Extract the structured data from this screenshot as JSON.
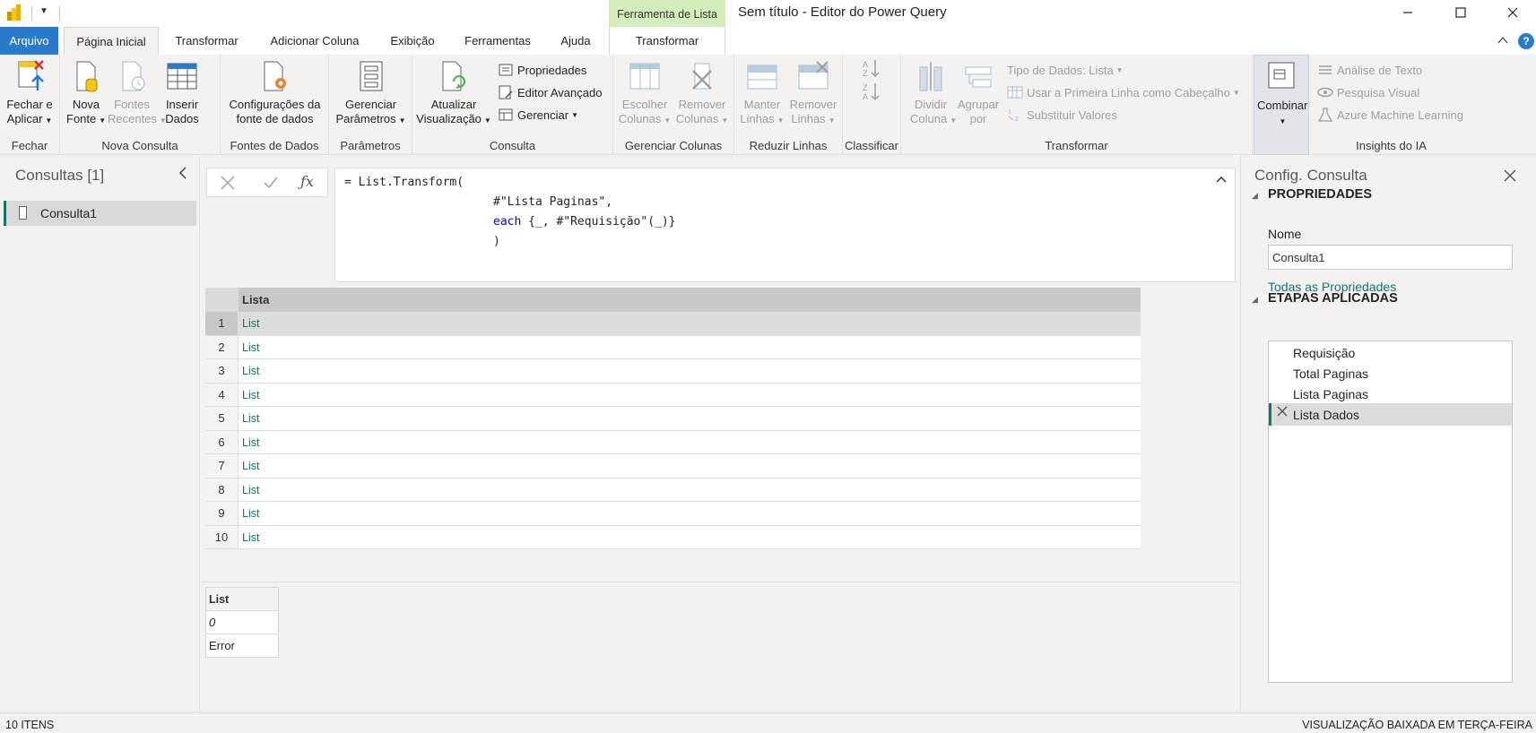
{
  "window": {
    "title": "Sem título - Editor do Power Query",
    "contextual_tab_group": "Ferramenta de Lista"
  },
  "tabs": [
    {
      "label": "Arquivo"
    },
    {
      "label": "Página Inicial"
    },
    {
      "label": "Transformar"
    },
    {
      "label": "Adicionar Coluna"
    },
    {
      "label": "Exibição"
    },
    {
      "label": "Ferramentas"
    },
    {
      "label": "Ajuda"
    },
    {
      "label": "Transformar"
    }
  ],
  "help_label": "?",
  "ribbon": {
    "fechar": {
      "label": "Fechar",
      "btn1": "Fechar e",
      "btn2": "Aplicar"
    },
    "nova_consulta": {
      "label": "Nova Consulta",
      "nova1": "Nova",
      "nova2": "Fonte",
      "rec1": "Fontes",
      "rec2": "Recentes",
      "ins1": "Inserir",
      "ins2": "Dados"
    },
    "fontes": {
      "label": "Fontes de Dados",
      "b1": "Configurações da",
      "b2": "fonte de dados"
    },
    "parametros": {
      "label": "Parâmetros",
      "b1": "Gerenciar",
      "b2": "Parâmetros"
    },
    "consulta": {
      "label": "Consulta",
      "b1": "Atualizar",
      "b2": "Visualização",
      "propriedades": "Propriedades",
      "editor": "Editor Avançado",
      "gerenciar": "Gerenciar"
    },
    "gerenciar_colunas": {
      "label": "Gerenciar Colunas",
      "e1": "Escolher",
      "e2": "Colunas",
      "r1": "Remover",
      "r2": "Colunas"
    },
    "reduzir_linhas": {
      "label": "Reduzir Linhas",
      "m1": "Manter",
      "m2": "Linhas",
      "r1": "Remover",
      "r2": "Linhas"
    },
    "classificar": {
      "label": "Classificar"
    },
    "transformar": {
      "label": "Transformar",
      "d1": "Dividir",
      "d2": "Coluna",
      "a1": "Agrupar",
      "a2": "por",
      "tipo": "Tipo de Dados: Lista",
      "primeira": "Usar a Primeira Linha como Cabeçalho",
      "substituir": "Substituir Valores"
    },
    "combinar": {
      "label": "Combinar"
    },
    "insights": {
      "label": "Insights do IA",
      "texto": "Análise de Texto",
      "visual": "Pesquisa Visual",
      "azure": "Azure Machine Learning"
    }
  },
  "queries_panel": {
    "title": "Consultas [1]",
    "items": [
      {
        "label": "Consulta1"
      }
    ]
  },
  "formula": {
    "line1_a": "= List.Transform(",
    "line2": "#\"Lista Paginas\",",
    "line3_kw": "each",
    "line3_rest": " {_, #\"Requisição\"(_)}",
    "line4": ")"
  },
  "grid": {
    "column": "Lista",
    "rows": [
      {
        "n": "1",
        "v": "List"
      },
      {
        "n": "2",
        "v": "List"
      },
      {
        "n": "3",
        "v": "List"
      },
      {
        "n": "4",
        "v": "List"
      },
      {
        "n": "5",
        "v": "List"
      },
      {
        "n": "6",
        "v": "List"
      },
      {
        "n": "7",
        "v": "List"
      },
      {
        "n": "8",
        "v": "List"
      },
      {
        "n": "9",
        "v": "List"
      },
      {
        "n": "10",
        "v": "List"
      }
    ]
  },
  "list_preview": {
    "header": "List",
    "items": [
      "0",
      "Error"
    ]
  },
  "settings_panel": {
    "title": "Config. Consulta",
    "properties_title": "PROPRIEDADES",
    "name_label": "Nome",
    "name_value": "Consulta1",
    "all_properties": "Todas as Propriedades",
    "steps_title": "ETAPAS APLICADAS",
    "steps": [
      "Requisição",
      "Total Paginas",
      "Lista Paginas",
      "Lista Dados"
    ]
  },
  "status": {
    "left": "10 ITENS",
    "right": "VISUALIZAÇÃO BAIXADA EM TERÇA-FEIRA"
  },
  "colors": {
    "accent": "#117865",
    "file_tab": "#2b7bcd",
    "contextual": "#d4edba"
  }
}
